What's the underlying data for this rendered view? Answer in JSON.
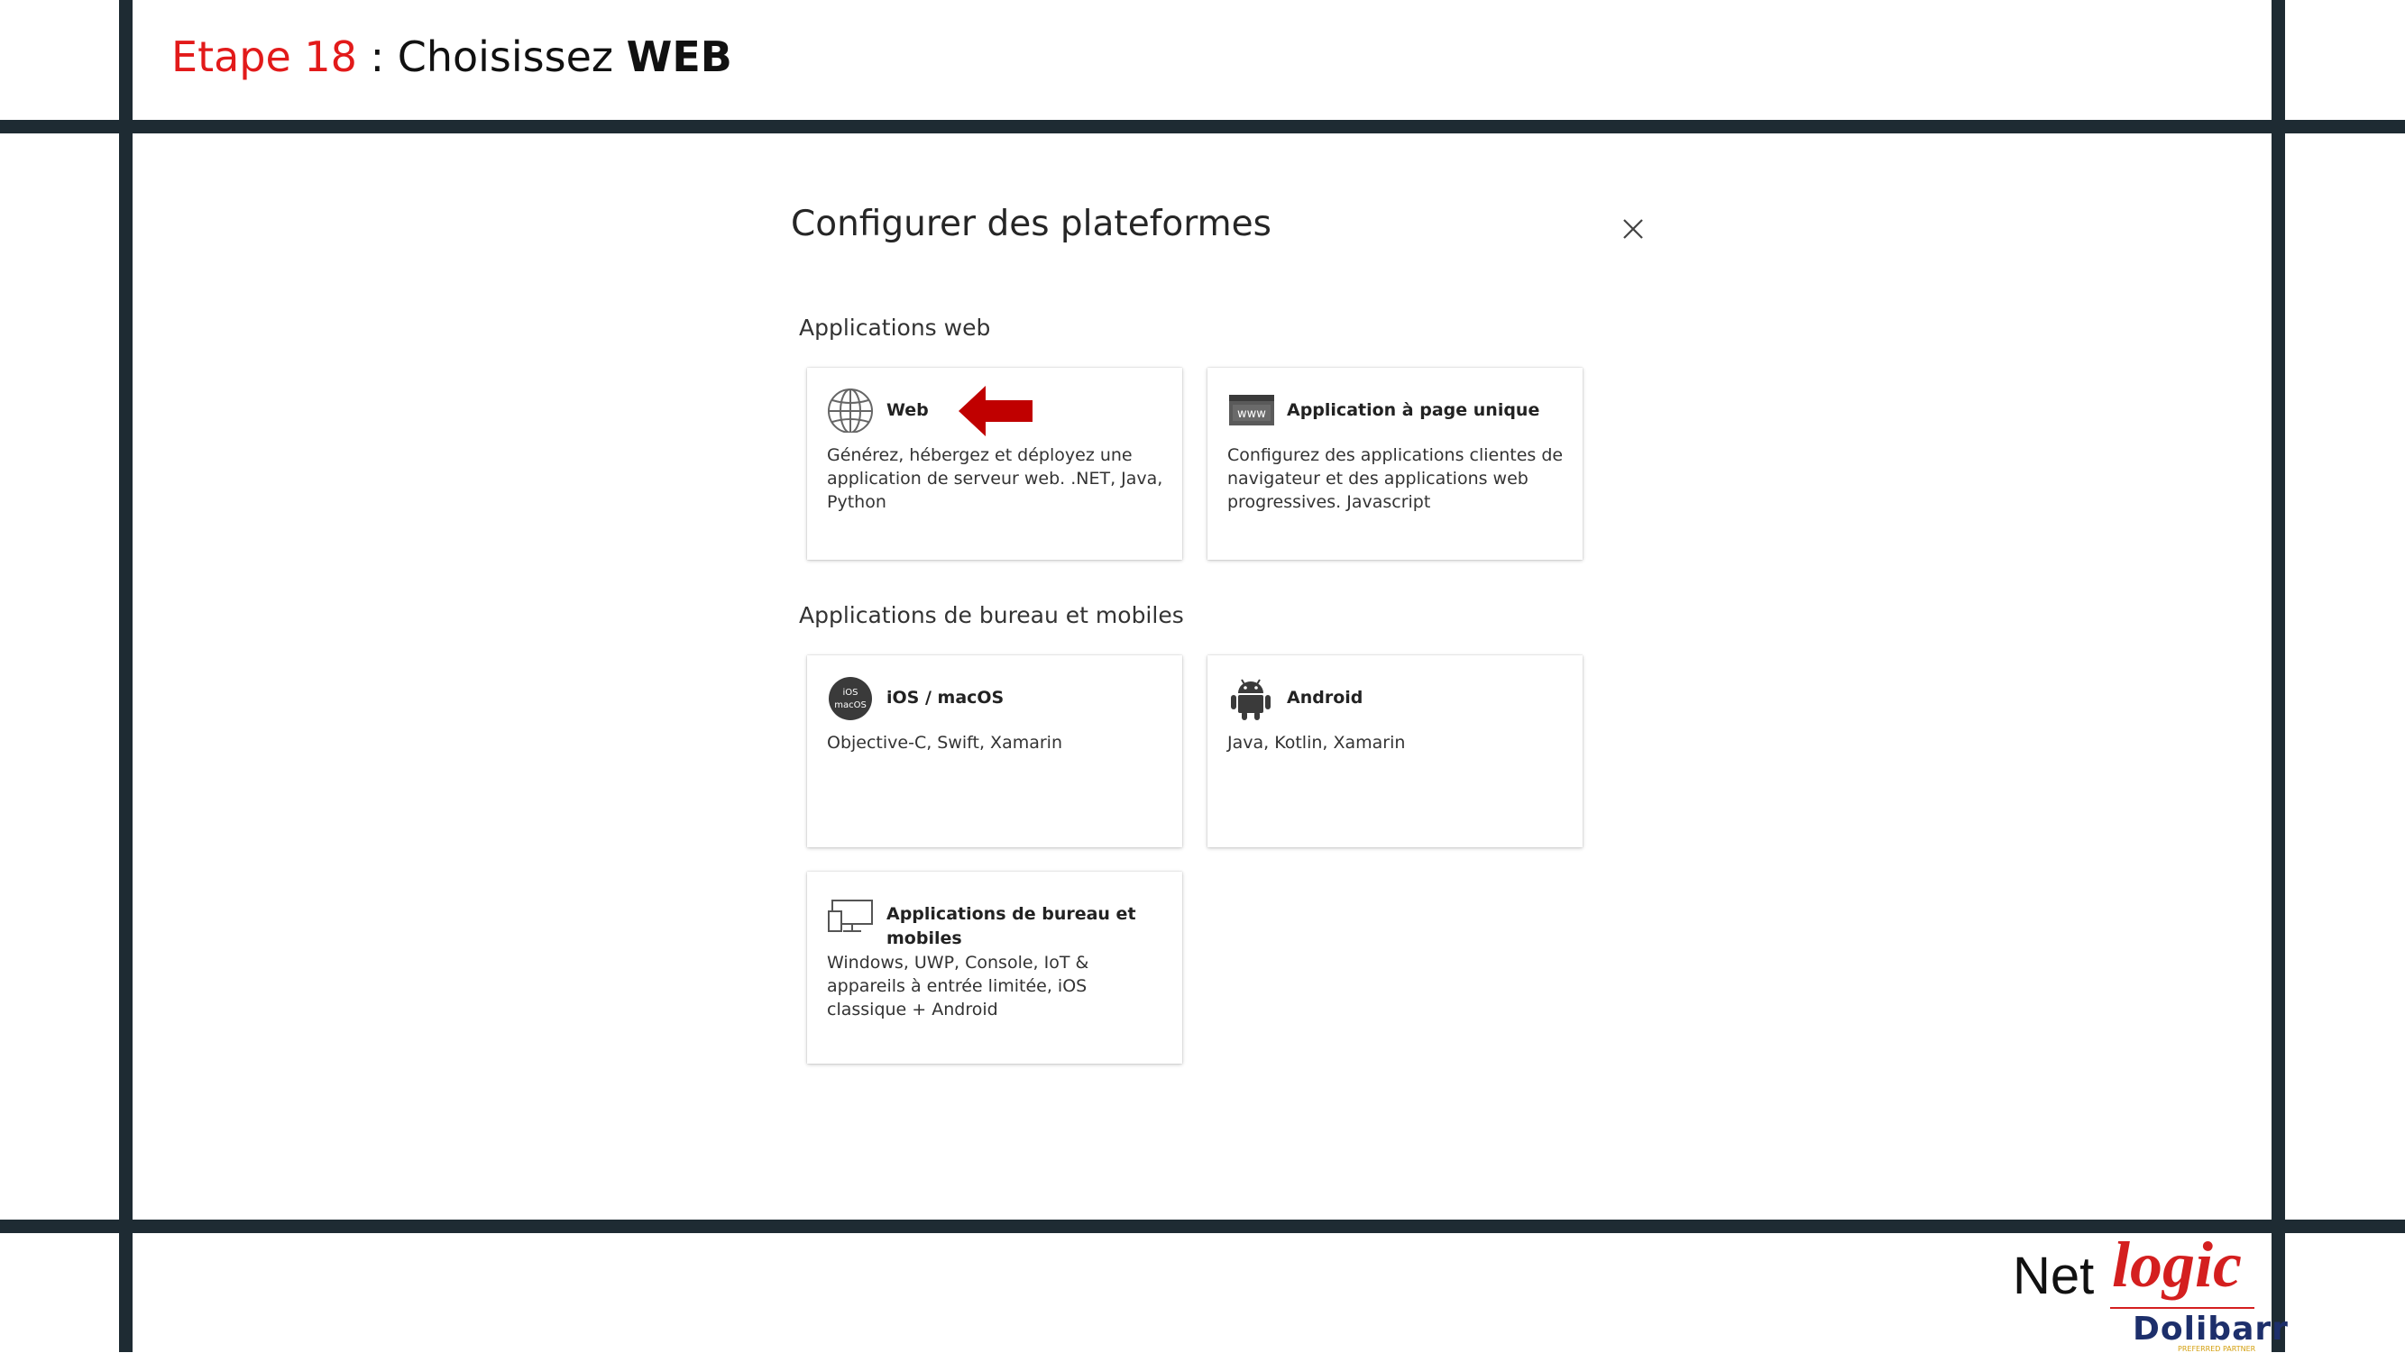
{
  "slide": {
    "step_label": "Etape 18",
    "instruction": " : Choisissez ",
    "emphasis": "WEB"
  },
  "panel": {
    "title": "Configurer des plateformes",
    "sections": [
      {
        "label": "Applications web",
        "cards": [
          {
            "title": "Web",
            "description": "Générez, hébergez et déployez une application de serveur web. .NET, Java, Python",
            "icon": "globe-icon"
          },
          {
            "title": "Application à page unique",
            "description": "Configurez des applications clientes de navigateur et des applications web progressives. Javascript",
            "icon": "www-icon",
            "icon_text": "www"
          }
        ]
      },
      {
        "label": "Applications de bureau et mobiles",
        "cards": [
          {
            "title": "iOS / macOS",
            "description": "Objective-C, Swift, Xamarin",
            "icon": "ios-macos-icon",
            "icon_text_1": "iOS",
            "icon_text_2": "macOS"
          },
          {
            "title": "Android",
            "description": "Java, Kotlin, Xamarin",
            "icon": "android-icon"
          },
          {
            "title": "Applications de bureau et mobiles",
            "description": "Windows, UWP, Console, IoT & appareils à entrée limitée, iOS classique + Android",
            "icon": "desktop-icon"
          }
        ]
      }
    ]
  },
  "logo": {
    "net": "Net",
    "logic": "logic",
    "dolibarr": "Dolibarr",
    "partner": "PREFERRED PARTNER"
  },
  "colors": {
    "frame": "#1e2b33",
    "step_red": "#e21a1a",
    "arrow_red": "#c00000",
    "logo_red": "#d41f1f",
    "dolibarr_blue": "#1d2f6b"
  }
}
